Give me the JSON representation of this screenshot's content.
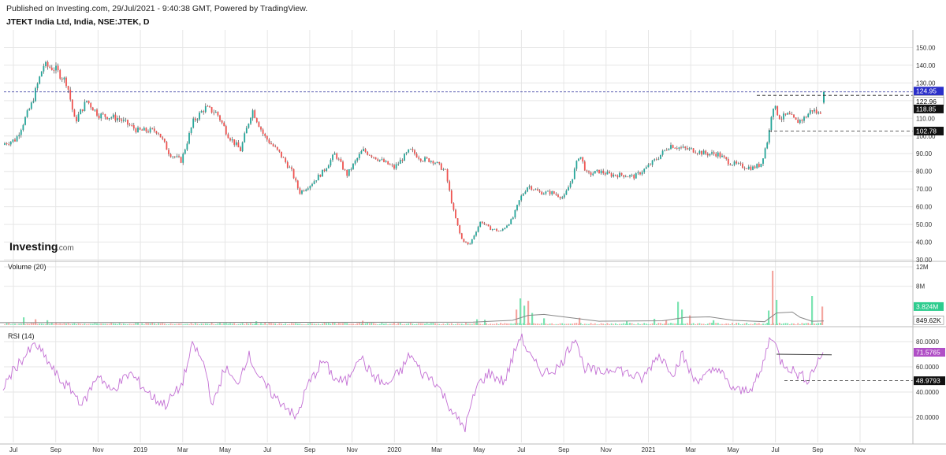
{
  "header": {
    "published": "Published on Investing.com, 29/Jul/2021 - 9:40:38 GMT, Powered by TradingView.",
    "title": "JTEKT India Ltd, India, NSE:JTEK, D"
  },
  "logo": {
    "main": "Investing",
    "suffix": ".com"
  },
  "colors": {
    "up": "#26a69a",
    "down": "#ef5350",
    "wick": "#333333",
    "vol_up": "#7be3b1",
    "vol_down": "#f4a6a0",
    "vol_ma": "#888888",
    "rsi": "#c36fd4",
    "level": "#2a2e9a",
    "dash": "#333333",
    "grid": "#e6e6e6"
  },
  "chart_data": [
    {
      "type": "candlestick",
      "pane": "price",
      "y_ticks": [
        "150.00",
        "140.00",
        "130.00",
        "120.00",
        "110.00",
        "100.00",
        "90.00",
        "80.00",
        "70.00",
        "60.00",
        "50.00",
        "40.00",
        "30.00"
      ],
      "ylim": [
        30,
        160
      ],
      "x_ticks": [
        "Jul",
        "Sep",
        "Nov",
        "2019",
        "Mar",
        "May",
        "Jul",
        "Sep",
        "Nov",
        "2020",
        "Mar",
        "May",
        "Jul",
        "Sep",
        "Nov",
        "2021",
        "Mar",
        "May",
        "Jul",
        "Sep",
        "Nov"
      ],
      "anchors": [
        [
          0,
          95
        ],
        [
          20,
          98
        ],
        [
          40,
          118
        ],
        [
          55,
          140
        ],
        [
          70,
          138
        ],
        [
          85,
          130
        ],
        [
          95,
          108
        ],
        [
          110,
          120
        ],
        [
          125,
          112
        ],
        [
          150,
          110
        ],
        [
          175,
          103
        ],
        [
          200,
          103
        ],
        [
          215,
          90
        ],
        [
          230,
          86
        ],
        [
          245,
          108
        ],
        [
          260,
          116
        ],
        [
          275,
          113
        ],
        [
          290,
          100
        ],
        [
          305,
          92
        ],
        [
          320,
          115
        ],
        [
          335,
          100
        ],
        [
          355,
          90
        ],
        [
          370,
          80
        ],
        [
          380,
          68
        ],
        [
          395,
          73
        ],
        [
          410,
          80
        ],
        [
          425,
          90
        ],
        [
          440,
          78
        ],
        [
          460,
          92
        ],
        [
          480,
          87
        ],
        [
          500,
          82
        ],
        [
          520,
          92
        ],
        [
          535,
          87
        ],
        [
          550,
          86
        ],
        [
          565,
          80
        ],
        [
          575,
          58
        ],
        [
          585,
          42
        ],
        [
          595,
          38
        ],
        [
          610,
          52
        ],
        [
          620,
          48
        ],
        [
          635,
          46
        ],
        [
          650,
          53
        ],
        [
          660,
          65
        ],
        [
          670,
          72
        ],
        [
          685,
          68
        ],
        [
          700,
          68
        ],
        [
          715,
          65
        ],
        [
          725,
          75
        ],
        [
          735,
          90
        ],
        [
          745,
          78
        ],
        [
          760,
          80
        ],
        [
          775,
          78
        ],
        [
          790,
          78
        ],
        [
          805,
          77
        ],
        [
          820,
          82
        ],
        [
          835,
          88
        ],
        [
          850,
          95
        ],
        [
          865,
          93
        ],
        [
          880,
          92
        ],
        [
          895,
          90
        ],
        [
          910,
          90
        ],
        [
          925,
          85
        ],
        [
          940,
          83
        ],
        [
          955,
          82
        ],
        [
          965,
          84
        ],
        [
          975,
          100
        ],
        [
          980,
          118
        ],
        [
          990,
          110
        ],
        [
          1000,
          112
        ],
        [
          1010,
          108
        ],
        [
          1020,
          110
        ],
        [
          1030,
          115
        ],
        [
          1040,
          112
        ],
        [
          1045,
          124.95
        ]
      ],
      "last": {
        "open": 118.85,
        "close": 124.95
      },
      "labels": [
        "124.95",
        "124.72",
        "122.96",
        "118.85",
        "102.78"
      ],
      "levels": [
        124.95,
        124.72,
        122.96,
        118.85,
        102.78
      ]
    },
    {
      "type": "bar",
      "pane": "volume",
      "name": "Volume (20)",
      "y_ticks": [
        "12M",
        "8M"
      ],
      "ylim": [
        0,
        12
      ],
      "ma_label": "849.62K",
      "last_label": "3.824M",
      "spikes": [
        [
          30,
          1.6
        ],
        [
          45,
          1.2
        ],
        [
          60,
          1.0
        ],
        [
          325,
          0.8
        ],
        [
          460,
          0.9
        ],
        [
          605,
          1.2
        ],
        [
          615,
          1.1
        ],
        [
          655,
          3.2
        ],
        [
          660,
          5.5
        ],
        [
          665,
          4.0
        ],
        [
          670,
          5.0
        ],
        [
          675,
          2.5
        ],
        [
          690,
          1.4
        ],
        [
          735,
          1.5
        ],
        [
          795,
          0.8
        ],
        [
          830,
          1.3
        ],
        [
          845,
          1.0
        ],
        [
          860,
          4.8
        ],
        [
          865,
          3.2
        ],
        [
          875,
          2.0
        ],
        [
          905,
          1.0
        ],
        [
          975,
          3.0
        ],
        [
          980,
          11.2
        ],
        [
          985,
          5.2
        ],
        [
          1030,
          6.0
        ],
        [
          1043,
          3.824
        ]
      ],
      "ma": [
        [
          0,
          0.5
        ],
        [
          600,
          0.6
        ],
        [
          650,
          1.0
        ],
        [
          670,
          2.0
        ],
        [
          690,
          2.2
        ],
        [
          720,
          1.6
        ],
        [
          760,
          0.8
        ],
        [
          840,
          0.9
        ],
        [
          870,
          1.6
        ],
        [
          900,
          1.7
        ],
        [
          930,
          1.0
        ],
        [
          970,
          0.7
        ],
        [
          985,
          2.5
        ],
        [
          1005,
          2.7
        ],
        [
          1015,
          1.6
        ],
        [
          1030,
          0.8
        ],
        [
          1045,
          0.85
        ]
      ]
    },
    {
      "type": "line",
      "pane": "rsi",
      "name": "RSI (14)",
      "y_ticks": [
        "80.0000",
        "60.0000",
        "40.0000",
        "20.0000"
      ],
      "ylim": [
        0,
        90
      ],
      "last_label": "71.5765",
      "level_label": "48.9793",
      "levels": [
        71.5765,
        48.9793
      ],
      "anchors": [
        [
          0,
          40
        ],
        [
          20,
          60
        ],
        [
          45,
          78
        ],
        [
          60,
          65
        ],
        [
          75,
          50
        ],
        [
          90,
          42
        ],
        [
          105,
          30
        ],
        [
          125,
          55
        ],
        [
          140,
          40
        ],
        [
          165,
          55
        ],
        [
          180,
          45
        ],
        [
          195,
          35
        ],
        [
          210,
          30
        ],
        [
          230,
          45
        ],
        [
          245,
          78
        ],
        [
          260,
          60
        ],
        [
          270,
          28
        ],
        [
          285,
          60
        ],
        [
          300,
          45
        ],
        [
          315,
          70
        ],
        [
          330,
          50
        ],
        [
          350,
          35
        ],
        [
          365,
          28
        ],
        [
          375,
          18
        ],
        [
          390,
          45
        ],
        [
          410,
          65
        ],
        [
          425,
          50
        ],
        [
          440,
          48
        ],
        [
          455,
          70
        ],
        [
          470,
          55
        ],
        [
          490,
          45
        ],
        [
          510,
          58
        ],
        [
          520,
          70
        ],
        [
          535,
          55
        ],
        [
          550,
          50
        ],
        [
          565,
          35
        ],
        [
          580,
          18
        ],
        [
          590,
          12
        ],
        [
          605,
          45
        ],
        [
          620,
          55
        ],
        [
          640,
          48
        ],
        [
          660,
          85
        ],
        [
          675,
          65
        ],
        [
          690,
          55
        ],
        [
          710,
          60
        ],
        [
          730,
          85
        ],
        [
          740,
          60
        ],
        [
          760,
          55
        ],
        [
          780,
          60
        ],
        [
          795,
          55
        ],
        [
          815,
          50
        ],
        [
          835,
          70
        ],
        [
          855,
          55
        ],
        [
          865,
          70
        ],
        [
          880,
          50
        ],
        [
          895,
          52
        ],
        [
          910,
          60
        ],
        [
          925,
          45
        ],
        [
          940,
          40
        ],
        [
          955,
          45
        ],
        [
          965,
          55
        ],
        [
          975,
          80
        ],
        [
          980,
          85
        ],
        [
          990,
          65
        ],
        [
          1000,
          60
        ],
        [
          1010,
          55
        ],
        [
          1025,
          50
        ],
        [
          1035,
          62
        ],
        [
          1045,
          71.5765
        ]
      ]
    }
  ]
}
